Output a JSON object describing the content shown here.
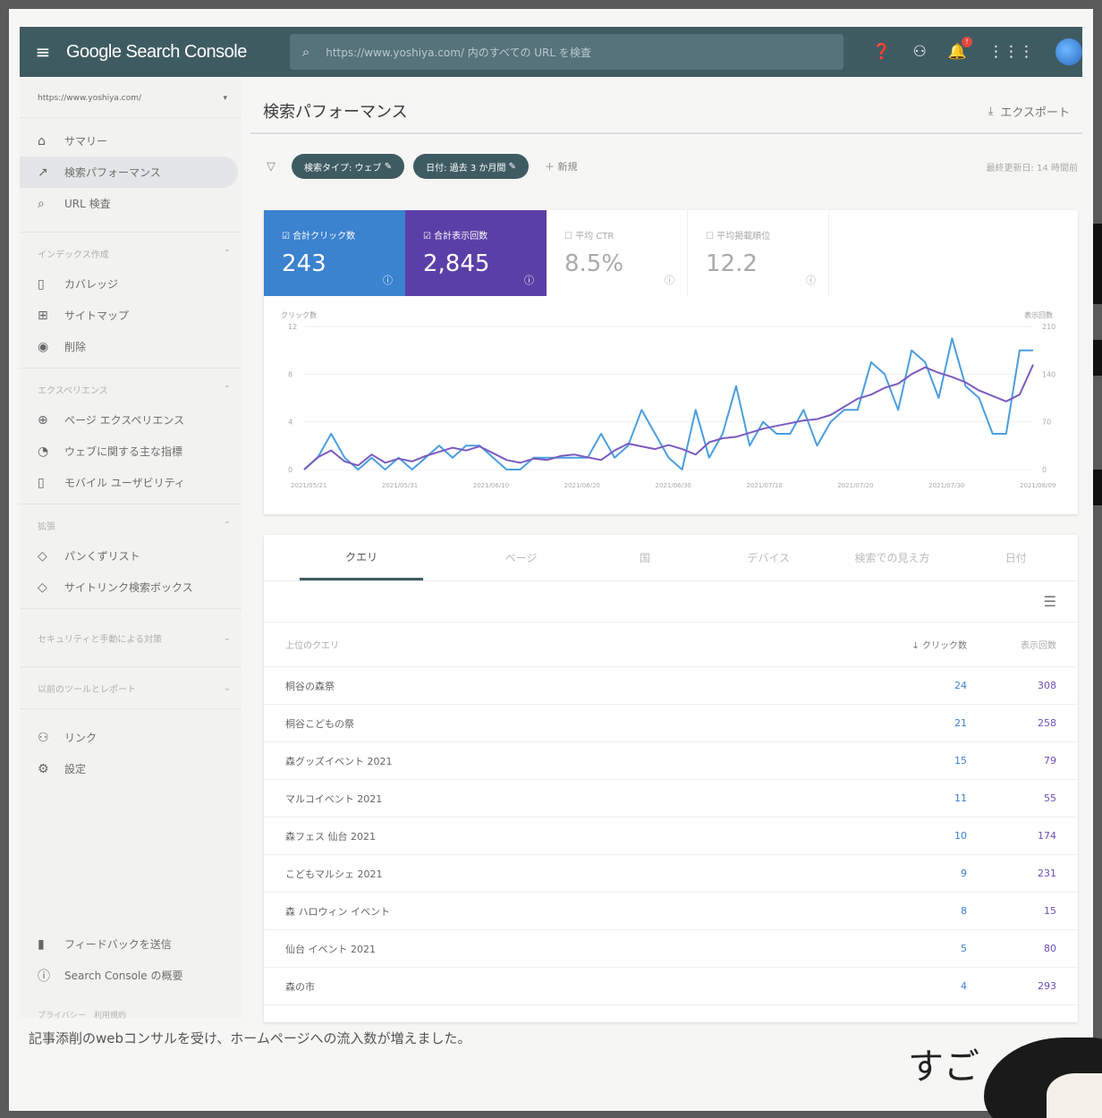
{
  "app": {
    "logo": "Google Search Console",
    "search_placeholder": "https://www.yoshiya.com/ 内のすべての URL を検査"
  },
  "sidebar": {
    "property": "https://www.yoshiya.com/",
    "items": [
      {
        "icon": "home-icon",
        "glyph": "⌂",
        "label": "サマリー",
        "active": false
      },
      {
        "icon": "trending-up-icon",
        "glyph": "↗",
        "label": "検索パフォーマンス",
        "active": true
      },
      {
        "icon": "search-icon",
        "glyph": "⌕",
        "label": "URL 検査",
        "active": false
      }
    ],
    "section_index": "インデックス作成",
    "index_items": [
      {
        "icon": "file-icon",
        "glyph": "▯",
        "label": "カバレッジ"
      },
      {
        "icon": "sitemap-icon",
        "glyph": "⊞",
        "label": "サイトマップ"
      },
      {
        "icon": "eye-icon",
        "glyph": "◉",
        "label": "削除"
      }
    ],
    "section_experience": "エクスペリエンス",
    "experience_items": [
      {
        "icon": "plus-circle-icon",
        "glyph": "⊕",
        "label": "ページ エクスペリエンス"
      },
      {
        "icon": "gauge-icon",
        "glyph": "◔",
        "label": "ウェブに関する主な指標"
      },
      {
        "icon": "phone-icon",
        "glyph": "▯",
        "label": "モバイル ユーザビリティ"
      }
    ],
    "section_enhancements": "拡張",
    "enhancement_items": [
      {
        "icon": "diamond-icon",
        "glyph": "◇",
        "label": "パンくずリスト"
      },
      {
        "icon": "diamond-icon",
        "glyph": "◇",
        "label": "サイトリンク検索ボックス"
      }
    ],
    "section_security": "セキュリティと手動による対策",
    "section_legacy": "以前のツールとレポート",
    "bottom_items": [
      {
        "icon": "people-icon",
        "glyph": "⚇",
        "label": "リンク"
      },
      {
        "icon": "gear-icon",
        "glyph": "⚙",
        "label": "設定"
      }
    ],
    "footer_items": [
      {
        "icon": "feedback-icon",
        "glyph": "▮",
        "label": "フィードバックを送信"
      },
      {
        "icon": "info-icon",
        "glyph": "ⓘ",
        "label": "Search Console の概要"
      }
    ],
    "privacy": "プライバシー　利用規約"
  },
  "main": {
    "title": "検索パフォーマンス",
    "export_label": "エクスポート",
    "chips": [
      "検索タイプ: ウェブ",
      "日付: 過去 3 か月間"
    ],
    "new_label": "新規",
    "updated": "最終更新日: 14 時間前"
  },
  "metrics": [
    {
      "label": "合計クリック数",
      "value": "243",
      "style": "clicks"
    },
    {
      "label": "合計表示回数",
      "value": "2,845",
      "style": "impr"
    },
    {
      "label": "平均 CTR",
      "value": "8.5%",
      "style": "plain"
    },
    {
      "label": "平均掲載順位",
      "value": "12.2",
      "style": "plain"
    }
  ],
  "chart_data": {
    "type": "line",
    "ylabel_left": "クリック数",
    "ylabel_right": "表示回数",
    "left_ticks": [
      "12",
      "8",
      "4",
      "0"
    ],
    "right_ticks": [
      "210",
      "140",
      "70",
      "0"
    ],
    "x_tick_labels": [
      "2021/05/21",
      "2021/05/31",
      "2021/06/10",
      "2021/06/20",
      "2021/06/30",
      "2021/07/10",
      "2021/07/20",
      "2021/07/30",
      "2021/08/09"
    ],
    "ylim_left": [
      0,
      12
    ],
    "ylim_right": [
      0,
      210
    ],
    "series": [
      {
        "name": "クリック数",
        "color": "#4a9ee0",
        "values": [
          0,
          1,
          3,
          1,
          0,
          1,
          0,
          1,
          0,
          1,
          2,
          1,
          2,
          2,
          1,
          0,
          0,
          1,
          1,
          1,
          1,
          1,
          3,
          1,
          2,
          5,
          3,
          1,
          0,
          5,
          1,
          3,
          7,
          2,
          4,
          3,
          3,
          5,
          2,
          4,
          5,
          5,
          9,
          8,
          5,
          10,
          9,
          6,
          11,
          7,
          6,
          3,
          3,
          10,
          10
        ]
      },
      {
        "name": "表示回数",
        "color": "#7b5bbf",
        "values": [
          0,
          18,
          28,
          12,
          6,
          22,
          10,
          16,
          12,
          20,
          26,
          32,
          28,
          34,
          24,
          14,
          10,
          16,
          14,
          20,
          22,
          18,
          14,
          28,
          38,
          34,
          30,
          36,
          30,
          22,
          40,
          46,
          48,
          54,
          60,
          64,
          68,
          72,
          74,
          80,
          92,
          104,
          110,
          120,
          126,
          140,
          150,
          142,
          136,
          128,
          116,
          108,
          100,
          110,
          154
        ]
      }
    ]
  },
  "table": {
    "tabs": [
      "クエリ",
      "ページ",
      "国",
      "デバイス",
      "検索での見え方",
      "日付"
    ],
    "active_tab": 0,
    "columns": {
      "query": "上位のクエリ",
      "clicks": "クリック数",
      "impressions": "表示回数"
    },
    "rows": [
      {
        "query": "桐谷の森祭",
        "clicks": "24",
        "impressions": "308"
      },
      {
        "query": "桐谷こどもの祭",
        "clicks": "21",
        "impressions": "258"
      },
      {
        "query": "森グッズイベント 2021",
        "clicks": "15",
        "impressions": "79"
      },
      {
        "query": "マルコイベント 2021",
        "clicks": "11",
        "impressions": "55"
      },
      {
        "query": "森フェス 仙台 2021",
        "clicks": "10",
        "impressions": "174"
      },
      {
        "query": "こどもマルシェ 2021",
        "clicks": "9",
        "impressions": "231"
      },
      {
        "query": "森 ハロウィン イベント",
        "clicks": "8",
        "impressions": "15"
      },
      {
        "query": "仙台 イベント 2021",
        "clicks": "5",
        "impressions": "80"
      },
      {
        "query": "森の市",
        "clicks": "4",
        "impressions": "293"
      }
    ]
  },
  "caption": "記事添削のwebコンサルを受け、ホームページへの流入数が増えました。",
  "manga_text": "すご"
}
